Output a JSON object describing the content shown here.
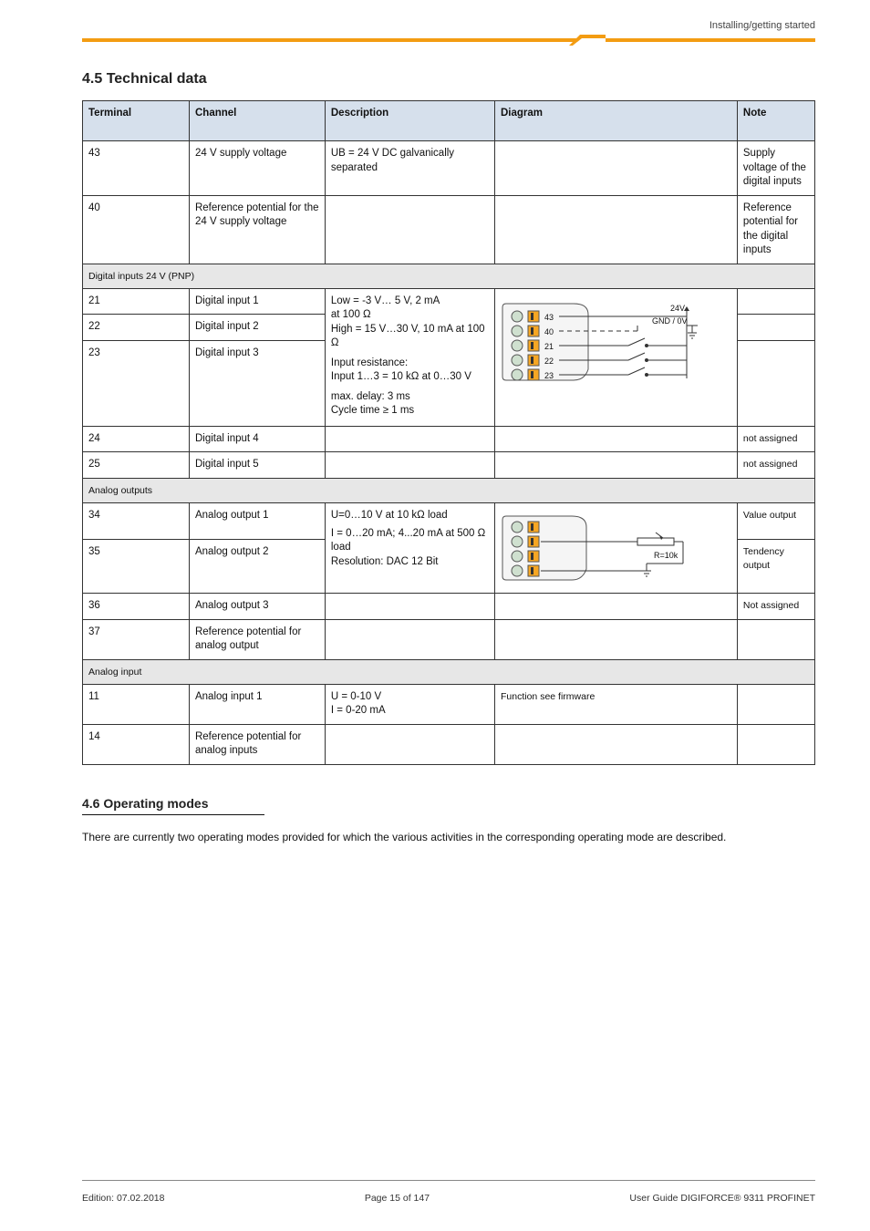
{
  "header": {
    "category_label": "Installing/getting started"
  },
  "title": "4.5 Technical data",
  "table": {
    "headers": [
      "Terminal",
      "Channel",
      "Description",
      "Diagram",
      "Note"
    ],
    "rows": [
      {
        "terminal": "43",
        "channel": "24 V supply voltage",
        "description": "UB = 24 V DC galvanically separated",
        "diagram": "",
        "note": "Supply voltage of the digital inputs"
      },
      {
        "terminal": "40",
        "channel": "Reference potential for the 24 V supply voltage",
        "description": "",
        "diagram": "",
        "note": "Reference potential for the digital inputs"
      }
    ],
    "section_dig_inputs": "Digital inputs 24 V (PNP)",
    "dig_rows": [
      {
        "terminal": "21",
        "channel": "Digital input 1",
        "desc_lines": [
          "Low = -3 V… 5 V, 2 mA"
        ],
        "note": ""
      },
      {
        "terminal": "22",
        "channel": "Digital input 2",
        "desc_lines": [
          "at 100 Ω",
          "High = 15 V…30 V, 10 mA at 100 Ω"
        ],
        "note": ""
      },
      {
        "terminal": "23",
        "channel": "Digital input 3",
        "desc_lines": [
          "Input resistance:",
          "Input 1…3  = 10 kΩ at 0…30 V",
          "max. delay: 3 ms",
          "Cycle time ≥ 1 ms"
        ],
        "note": ""
      },
      {
        "terminal": "24",
        "channel": "Digital input 4",
        "desc_lines": [],
        "note": "not assigned"
      },
      {
        "terminal": "25",
        "channel": "Digital input 5",
        "desc_lines": [],
        "note": "not assigned"
      }
    ],
    "section_ana_out": "Analog outputs",
    "ana_out_rows": [
      {
        "terminal": "34",
        "channel": "Analog output 1",
        "desc_lines": [
          "U=0…10 V at 10 kΩ load"
        ],
        "note": "Value output"
      },
      {
        "terminal": "35",
        "channel": "Analog output 2",
        "desc_lines": [
          "I = 0…20 mA; 4...20 mA at 500 Ω load",
          "Resolution: DAC 12 Bit"
        ],
        "note": "Tendency output"
      },
      {
        "terminal": "36",
        "channel": "Analog output 3",
        "desc_lines": [],
        "note": "Not assigned"
      },
      {
        "terminal": "37",
        "channel": "Reference potential for analog output",
        "desc_lines": [],
        "note": ""
      }
    ],
    "section_ana_in": "Analog input",
    "ana_in_rows": [
      {
        "terminal": "11",
        "channel": "Analog input 1",
        "desc_lines": [
          "U = 0-10 V",
          "I = 0-20 mA"
        ],
        "diagram": "Function see firmware",
        "note": ""
      },
      {
        "terminal": "14",
        "channel": "Reference potential for analog inputs",
        "desc_lines": [],
        "diagram": "",
        "note": ""
      }
    ]
  },
  "bottom": {
    "subhead": "4.6 Operating modes",
    "text": "There are currently two operating modes provided for which the various activities in the corresponding operating mode are described."
  },
  "footer": {
    "left": "Edition: 07.02.2018",
    "center": "Page 15 of 147",
    "right": "User Guide DIGIFORCE® 9311 PROFINET"
  }
}
